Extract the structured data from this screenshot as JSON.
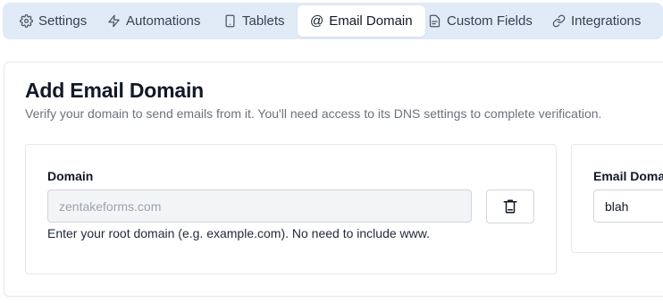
{
  "tabs": [
    {
      "label": "Settings",
      "icon": "gear-icon"
    },
    {
      "label": "Automations",
      "icon": "lightning-icon"
    },
    {
      "label": "Tablets",
      "icon": "tablet-icon"
    },
    {
      "label": "Email Domain",
      "icon": "at-icon",
      "active": true
    },
    {
      "label": "Custom Fields",
      "icon": "form-icon"
    },
    {
      "label": "Integrations",
      "icon": "link-icon"
    }
  ],
  "page": {
    "title": "Add Email Domain",
    "subtitle": "Verify your domain to send emails from it. You'll need access to its DNS settings to complete verification."
  },
  "domain_panel": {
    "label": "Domain",
    "placeholder": "zentakeforms.com",
    "helper": "Enter your root domain (e.g. example.com). No need to include www.",
    "delete_icon": "trash-icon"
  },
  "email_panel": {
    "label": "Email Doma",
    "value": "blah"
  },
  "colors": {
    "tabbar_bg": "#e1eaf7",
    "active_tab_bg": "#ffffff",
    "subtitle": "#6b7280",
    "disabled_input_bg": "#f3f4f6"
  }
}
